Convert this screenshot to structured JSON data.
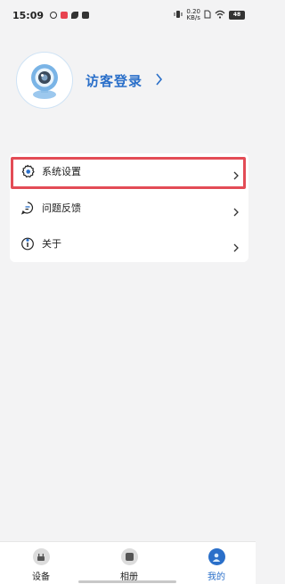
{
  "status_bar": {
    "time": "15:09",
    "net_speed_value": "0.20",
    "net_speed_unit": "KB/s",
    "battery": "48"
  },
  "profile": {
    "login_label": "访客登录"
  },
  "menu": {
    "items": [
      {
        "label": "系统设置",
        "icon": "gear-icon"
      },
      {
        "label": "问题反馈",
        "icon": "feedback-icon"
      },
      {
        "label": "关于",
        "icon": "info-icon"
      }
    ]
  },
  "bottom_nav": {
    "items": [
      {
        "label": "设备",
        "icon": "device-icon"
      },
      {
        "label": "相册",
        "icon": "album-icon"
      },
      {
        "label": "我的",
        "icon": "profile-icon",
        "active": true
      }
    ]
  },
  "colors": {
    "accent": "#2a6fc9",
    "highlight": "#e34c56",
    "background": "#f3f3f4"
  }
}
